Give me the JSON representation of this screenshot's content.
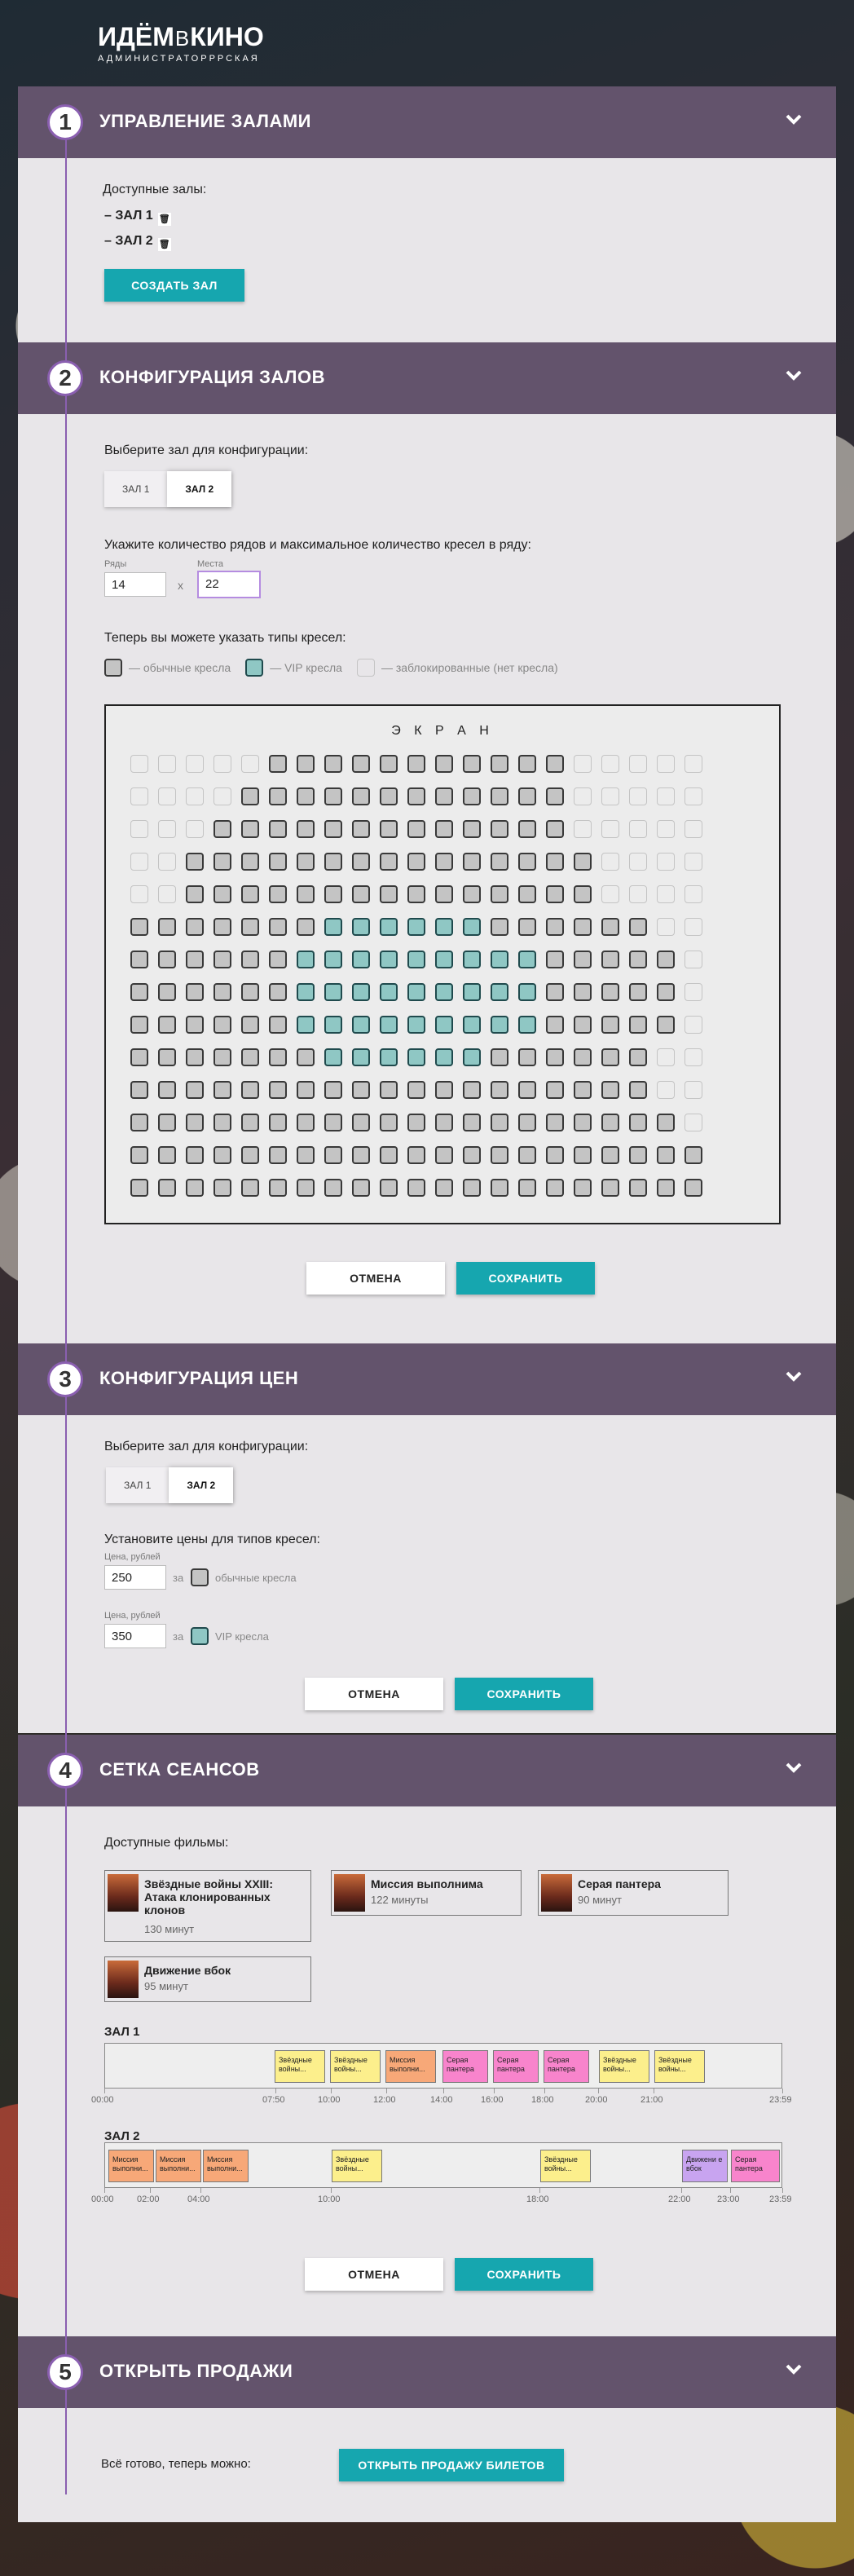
{
  "logo": {
    "part1": "ИДЁМ",
    "v": "В",
    "part2": "КИНО",
    "sub": "АДМИНИСТРАТОРРРСКАЯ"
  },
  "colors": {
    "header": "#63536c",
    "accent": "#8a5fb0",
    "teal": "#16a6af",
    "body": "#e8e6e9"
  },
  "icons": {
    "chevron": "chevron-down-icon",
    "trash": "trash-icon"
  },
  "sections": {
    "halls": {
      "num": "1",
      "title": "Управление залами",
      "available": "Доступные залы:",
      "list": [
        "– ЗАЛ 1",
        "– ЗАЛ 2"
      ],
      "create": "Создать зал"
    },
    "config": {
      "num": "2",
      "title": "Конфигурация залов",
      "choose": "Выберите зал для конфигурации:",
      "tabs": [
        "Зал 1",
        "Зал 2"
      ],
      "size_label": "Укажите количество рядов и максимальное количество кресел в ряду:",
      "rows_label": "Ряды",
      "rows_value": "14",
      "x": "x",
      "seats_label": "Места",
      "seats_value": "22",
      "types_label": "Теперь вы можете указать типы кресел:",
      "legend": {
        "standard": "— обычные кресла",
        "vip": "— VIP кресла",
        "blocked": "— заблокированные (нет кресла)"
      },
      "screen": "Э К Р А Н",
      "seat_rows": [
        "bbbbbsssssssssssbbbbb",
        "bbbbssssssssssssbbbbb",
        "bbbsssssssssssssbbbbb",
        "bbsssssssssssssssbbbb",
        "bbsssssssssssssssbbbb",
        "sssssssvvvvvvssssssbb",
        "ssssssvvvvvvvvvsssssb",
        "ssssssvvvvvvvvvsssssb",
        "ssssssvvvvvvvvvsssssb",
        "sssssssvvvvvvssssssbb",
        "sssssssssssssssssssbb",
        "ssssssssssssssssssssb",
        "sssssssssssssssssssss",
        "sssssssssssssssssssss"
      ],
      "cancel": "Отмена",
      "save": "Сохранить"
    },
    "prices": {
      "num": "3",
      "title": "Конфигурация цен",
      "choose": "Выберите зал для конфигурации:",
      "tabs": [
        "Зал 1",
        "Зал 2"
      ],
      "set_label": "Установите цены для типов кресел:",
      "price_label": "Цена, рублей",
      "for": "за",
      "standard_price": "250",
      "standard_label": "обычные кресла",
      "vip_price": "350",
      "vip_label": "VIP кресла",
      "cancel": "Отмена",
      "save": "Сохранить"
    },
    "sessions": {
      "num": "4",
      "title": "Сетка сеансов",
      "films_label": "Доступные фильмы:",
      "films": [
        {
          "title": "Звёздные войны XXIII: Атака клонированных клонов",
          "duration": "130 минут",
          "color": "#fcef8c"
        },
        {
          "title": "Миссия выполнима",
          "duration": "122 минуты",
          "color": "#f7a878"
        },
        {
          "title": "Серая пантера",
          "duration": "90 минут",
          "color": "#f884cc"
        },
        {
          "title": "Движение вбок",
          "duration": "95 минут",
          "color": "#c8a4f0"
        }
      ],
      "hall1": {
        "label": "ЗАЛ 1",
        "ticks": [
          "00:00",
          "07:50",
          "10:00",
          "12:00",
          "14:00",
          "16:00",
          "18:00",
          "20:00",
          "21:00",
          "23:59"
        ],
        "sessions": [
          {
            "label": "Звёздные войны...",
            "color": "#fcef8c"
          },
          {
            "label": "Звёздные войны...",
            "color": "#fcef8c"
          },
          {
            "label": "Миссия выполни...",
            "color": "#f7a878"
          },
          {
            "label": "Серая пантера",
            "color": "#f884cc"
          },
          {
            "label": "Серая пантера",
            "color": "#f884cc"
          },
          {
            "label": "Серая пантера",
            "color": "#f884cc"
          },
          {
            "label": "Звёздные войны...",
            "color": "#fcef8c"
          },
          {
            "label": "Звёздные войны...",
            "color": "#fcef8c"
          }
        ]
      },
      "hall2": {
        "label": "ЗАЛ 2",
        "ticks": [
          "00:00",
          "02:00",
          "04:00",
          "10:00",
          "18:00",
          "22:00",
          "23:00",
          "23:59"
        ],
        "sessions": [
          {
            "label": "Миссия выполни...",
            "color": "#f7a878"
          },
          {
            "label": "Миссия выполни...",
            "color": "#f7a878"
          },
          {
            "label": "Миссия выполни...",
            "color": "#f7a878"
          },
          {
            "label": "Звёздные войны...",
            "color": "#fcef8c"
          },
          {
            "label": "Звёздные войны...",
            "color": "#fcef8c"
          },
          {
            "label": "Движени е вбок",
            "color": "#c8a4f0"
          },
          {
            "label": "Серая пантера",
            "color": "#f884cc"
          }
        ]
      },
      "cancel": "Отмена",
      "save": "Сохранить"
    },
    "open": {
      "num": "5",
      "title": "Открыть продажи",
      "ready": "Всё готово, теперь можно:",
      "button": "Открыть продажу билетов"
    }
  }
}
